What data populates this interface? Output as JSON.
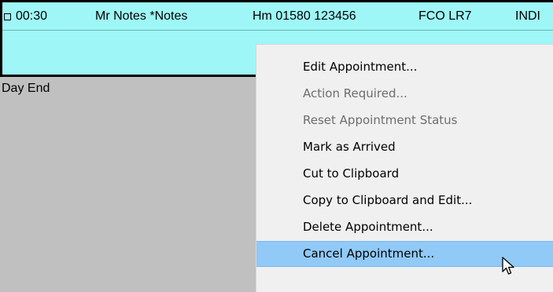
{
  "appointment": {
    "time": "00:30",
    "name": "Mr Notes *Notes",
    "phone": "Hm 01580 123456",
    "location": "FCO LR7",
    "status_fragment": "INDI"
  },
  "day_end_label": "Day End",
  "context_menu": {
    "items": [
      {
        "label": "Edit Appointment...",
        "enabled": true
      },
      {
        "label": "Action Required...",
        "enabled": false
      },
      {
        "label": "Reset Appointment Status",
        "enabled": false
      },
      {
        "label": "Mark as Arrived",
        "enabled": true
      },
      {
        "label": "Cut to Clipboard",
        "enabled": true
      },
      {
        "label": "Copy to Clipboard and Edit...",
        "enabled": true
      },
      {
        "label": "Delete Appointment...",
        "enabled": true
      },
      {
        "label": "Cancel Appointment...",
        "enabled": true,
        "highlighted": true
      }
    ]
  },
  "cursor_icon": "arrow-cursor-icon",
  "colors": {
    "appointment_bg": "#9ff6f6",
    "background": "#c0c0c0",
    "menu_bg": "#f0f0f0",
    "highlight": "#91c9f7",
    "disabled_text": "#6d6d6d"
  }
}
